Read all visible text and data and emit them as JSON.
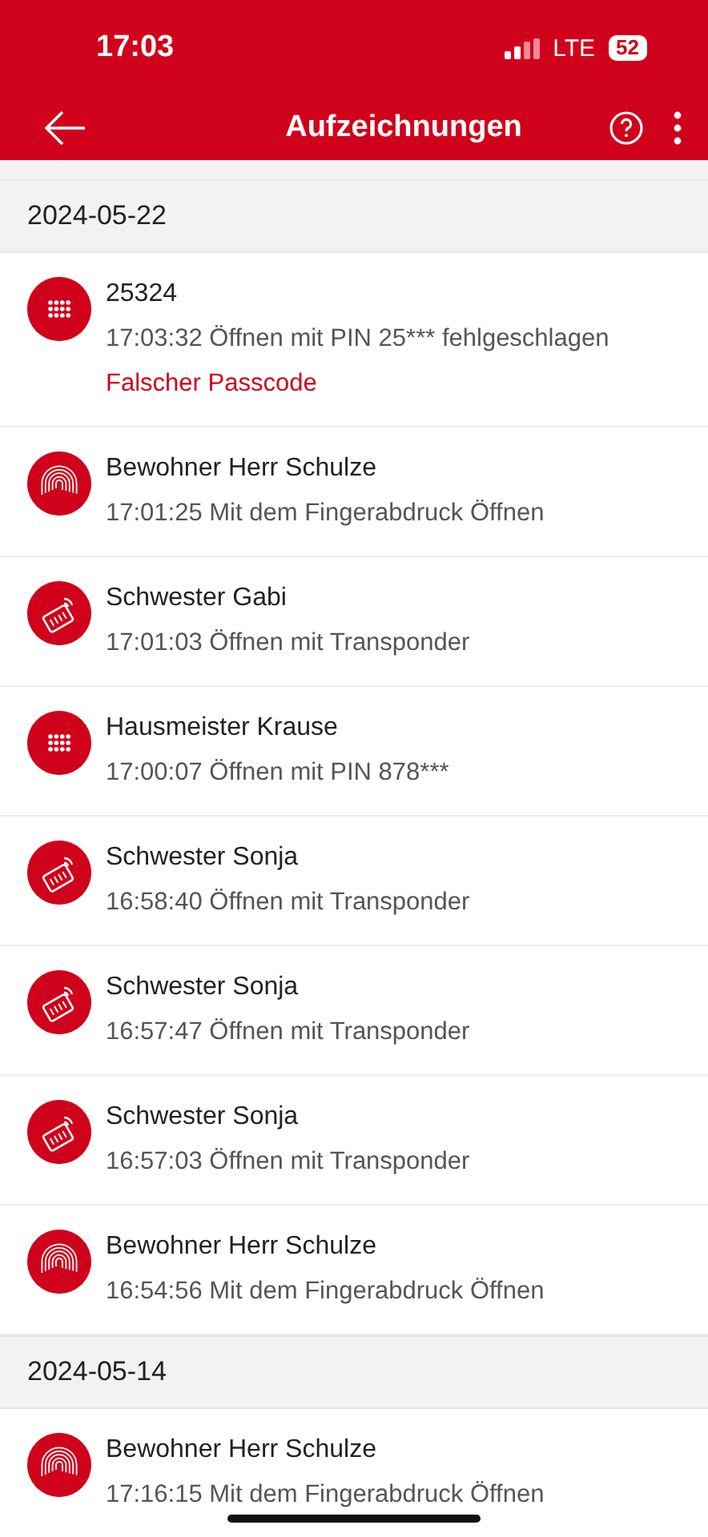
{
  "status_bar": {
    "time": "17:03",
    "network": "LTE",
    "battery": "52"
  },
  "header": {
    "title": "Aufzeichnungen"
  },
  "sections": [
    {
      "date": "2024-05-22",
      "records": [
        {
          "kind": "pin",
          "name": "25324",
          "detail": "17:03:32 Öffnen mit PIN 25*** fehlgeschlagen",
          "note": "Falscher Passcode"
        },
        {
          "kind": "fingerprint",
          "name": "Bewohner Herr Schulze",
          "detail": "17:01:25 Mit dem Fingerabdruck Öffnen"
        },
        {
          "kind": "transponder",
          "name": "Schwester Gabi",
          "detail": "17:01:03 Öffnen mit Transponder"
        },
        {
          "kind": "pin",
          "name": "Hausmeister Krause",
          "detail": "17:00:07 Öffnen mit PIN 878***"
        },
        {
          "kind": "transponder",
          "name": "Schwester Sonja",
          "detail": "16:58:40 Öffnen mit Transponder"
        },
        {
          "kind": "transponder",
          "name": "Schwester Sonja",
          "detail": "16:57:47 Öffnen mit Transponder"
        },
        {
          "kind": "transponder",
          "name": "Schwester Sonja",
          "detail": "16:57:03 Öffnen mit Transponder"
        },
        {
          "kind": "fingerprint",
          "name": "Bewohner Herr Schulze",
          "detail": "16:54:56 Mit dem Fingerabdruck Öffnen"
        }
      ]
    },
    {
      "date": "2024-05-14",
      "records": [
        {
          "kind": "fingerprint",
          "name": "Bewohner Herr Schulze",
          "detail": "17:16:15 Mit dem Fingerabdruck Öffnen"
        }
      ]
    }
  ]
}
